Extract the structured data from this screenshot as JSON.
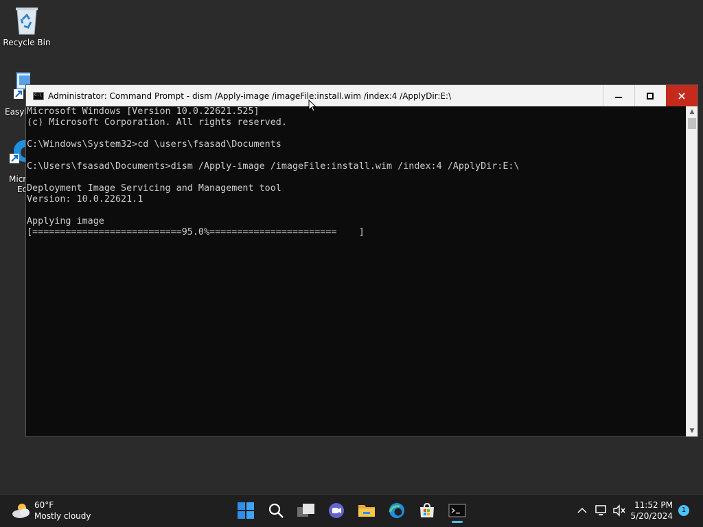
{
  "desktop": {
    "icons": [
      {
        "label": "Recycle Bin"
      },
      {
        "label": "EasyB"
      },
      {
        "label": "Micr"
      },
      {
        "label": "Ed"
      }
    ]
  },
  "window": {
    "title": "Administrator: Command Prompt - dism  /Apply-image /imageFile:install.wim /index:4 /ApplyDir:E:\\",
    "buttons": {
      "minimize": "—",
      "maximize": "☐",
      "close": "✕"
    }
  },
  "console": {
    "lines": [
      "Microsoft Windows [Version 10.0.22621.525]",
      "(c) Microsoft Corporation. All rights reserved.",
      "",
      "C:\\Windows\\System32>cd \\users\\fsasad\\Documents",
      "",
      "C:\\Users\\fsasad\\Documents>dism /Apply-image /imageFile:install.wim /index:4 /ApplyDir:E:\\",
      "",
      "Deployment Image Servicing and Management tool",
      "Version: 10.0.22621.1",
      "",
      "Applying image",
      "[===========================95.0%=======================    ]"
    ],
    "progress_percent": 95.0
  },
  "taskbar": {
    "weather": {
      "temp": "60°F",
      "desc": "Mostly cloudy"
    },
    "time": "11:52 PM",
    "date": "5/20/2024",
    "notification_count": "1",
    "accent": "#4cc2ff"
  }
}
